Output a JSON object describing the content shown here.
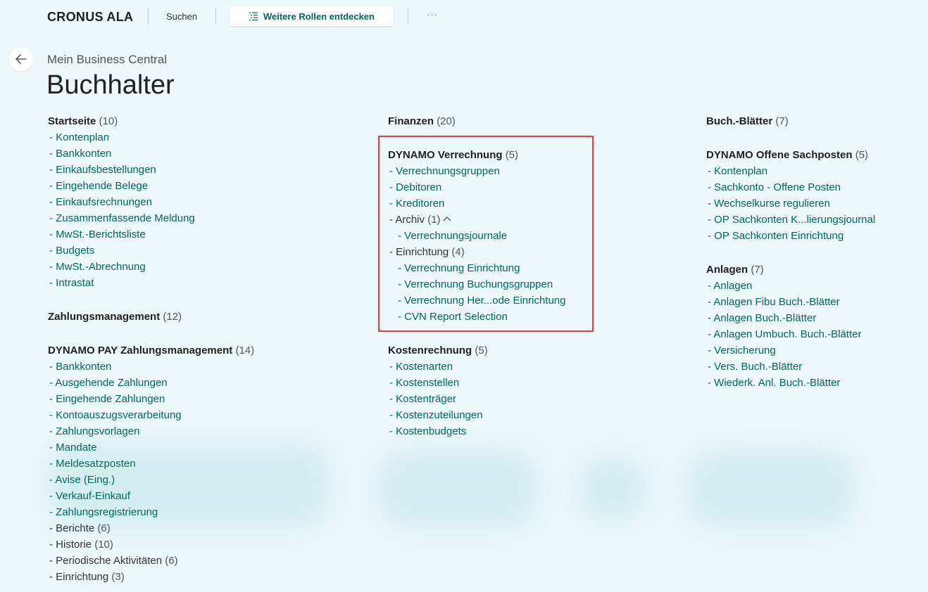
{
  "topbar": {
    "company": "CRONUS ALA",
    "search_label": "Suchen",
    "roles_button_label": "Weitere Rollen entdecken",
    "more_label": "···"
  },
  "header": {
    "breadcrumb": "Mein Business Central",
    "title": "Buchhalter"
  },
  "col1": {
    "startseite": {
      "title": "Startseite",
      "count": "(10)",
      "items": [
        "Kontenplan",
        "Bankkonten",
        "Einkaufsbestellungen",
        "Eingehende Belege",
        "Einkaufsrechnungen",
        "Zusammenfassende Meldung",
        "MwSt.-Berichtsliste",
        "Budgets",
        "MwSt.-Abrechnung",
        "Intrastat"
      ]
    },
    "zahlungsmanagement": {
      "title": "Zahlungsmanagement",
      "count": "(12)"
    },
    "dynamo_pay": {
      "title": "DYNAMO PAY Zahlungsmanagement",
      "count": "(14)",
      "items": [
        "Bankkonten",
        "Ausgehende Zahlungen",
        "Eingehende Zahlungen",
        "Kontoauszugsverarbeitung",
        "Zahlungsvorlagen",
        "Mandate",
        "Meldesatzposten",
        "Avise (Eing.)",
        "Verkauf-Einkauf",
        "Zahlungsregistrierung"
      ],
      "folders": [
        {
          "label": "Berichte",
          "count": "(6)"
        },
        {
          "label": "Historie",
          "count": "(10)"
        },
        {
          "label": "Periodische Aktivitäten",
          "count": "(6)"
        },
        {
          "label": "Einrichtung",
          "count": "(3)"
        }
      ]
    }
  },
  "col2": {
    "finanzen": {
      "title": "Finanzen",
      "count": "(20)"
    },
    "dynamo_verrechnung": {
      "title": "DYNAMO Verrechnung",
      "count": "(5)",
      "items": [
        "Verrechnungsgruppen",
        "Debitoren",
        "Kreditoren"
      ],
      "archiv": {
        "label": "Archiv",
        "count": "(1)",
        "items": [
          "Verrechnungsjournale"
        ]
      },
      "einrichtung": {
        "label": "Einrichtung",
        "count": "(4)",
        "items": [
          "Verrechnung Einrichtung",
          "Verrechnung Buchungsgruppen",
          "Verrechnung Her...ode Einrichtung",
          "CVN Report Selection"
        ]
      }
    },
    "kostenrechnung": {
      "title": "Kostenrechnung",
      "count": "(5)",
      "items": [
        "Kostenarten",
        "Kostenstellen",
        "Kostenträger",
        "Kostenzuteilungen",
        "Kostenbudgets"
      ]
    }
  },
  "col3": {
    "buchblaetter": {
      "title": "Buch.-Blätter",
      "count": "(7)"
    },
    "dynamo_offene": {
      "title": "DYNAMO Offene Sachposten",
      "count": "(5)",
      "items": [
        "Kontenplan",
        "Sachkonto - Offene Posten",
        "Wechselkurse regulieren",
        "OP Sachkonten K...lierungsjournal",
        "OP Sachkonten Einrichtung"
      ]
    },
    "anlagen": {
      "title": "Anlagen",
      "count": "(7)",
      "items": [
        "Anlagen",
        "Anlagen Fibu Buch.-Blätter",
        "Anlagen Buch.-Blätter",
        "Anlagen Umbuch. Buch.-Blätter",
        "Versicherung",
        "Vers. Buch.-Blätter",
        "Wiederk. Anl. Buch.-Blätter"
      ]
    }
  },
  "colors": {
    "accent": "#00685f",
    "highlight": "#d9424a",
    "background": "#ecf8f9"
  },
  "icons": {
    "roles": "list-icon",
    "back": "arrow-left-icon",
    "collapse": "chevron-up-icon"
  }
}
